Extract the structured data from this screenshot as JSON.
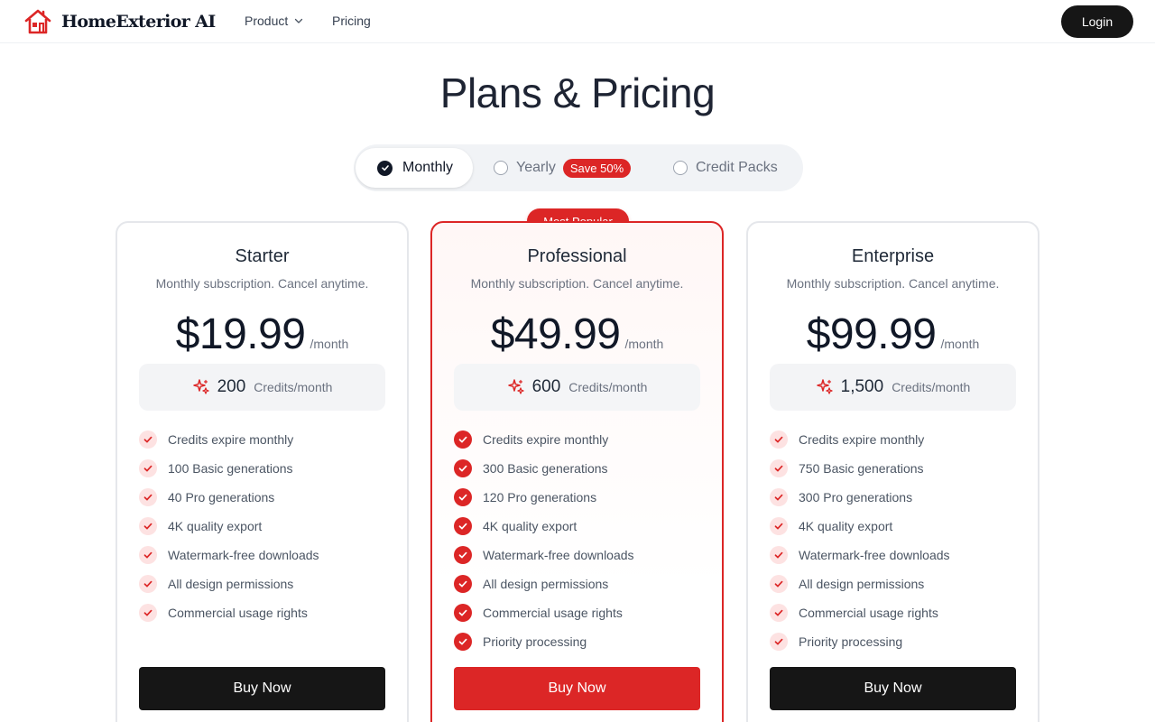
{
  "header": {
    "brand": "HomeExterior AI",
    "nav": {
      "product": "Product",
      "pricing": "Pricing"
    },
    "login": "Login"
  },
  "page": {
    "title": "Plans & Pricing"
  },
  "billing": {
    "selected": "monthly",
    "options": {
      "monthly": "Monthly",
      "yearly": "Yearly",
      "yearly_badge": "Save 50%",
      "credit_packs": "Credit Packs"
    }
  },
  "colors": {
    "accent": "#dc2626",
    "dark": "#161616",
    "muted": "#6b7280"
  },
  "plans": [
    {
      "name": "Starter",
      "description": "Monthly subscription. Cancel anytime.",
      "price": "$19.99",
      "period": "/month",
      "credits": "200",
      "credits_unit": "Credits/month",
      "features": [
        "Credits expire monthly",
        "100 Basic generations",
        "40 Pro generations",
        "4K quality export",
        "Watermark-free downloads",
        "All design permissions",
        "Commercial usage rights"
      ],
      "cta": "Buy Now"
    },
    {
      "name": "Professional",
      "badge": "Most Popular",
      "description": "Monthly subscription. Cancel anytime.",
      "price": "$49.99",
      "period": "/month",
      "credits": "600",
      "credits_unit": "Credits/month",
      "features": [
        "Credits expire monthly",
        "300 Basic generations",
        "120 Pro generations",
        "4K quality export",
        "Watermark-free downloads",
        "All design permissions",
        "Commercial usage rights",
        "Priority processing"
      ],
      "cta": "Buy Now"
    },
    {
      "name": "Enterprise",
      "description": "Monthly subscription. Cancel anytime.",
      "price": "$99.99",
      "period": "/month",
      "credits": "1,500",
      "credits_unit": "Credits/month",
      "features": [
        "Credits expire monthly",
        "750 Basic generations",
        "300 Pro generations",
        "4K quality export",
        "Watermark-free downloads",
        "All design permissions",
        "Commercial usage rights",
        "Priority processing"
      ],
      "cta": "Buy Now"
    }
  ]
}
